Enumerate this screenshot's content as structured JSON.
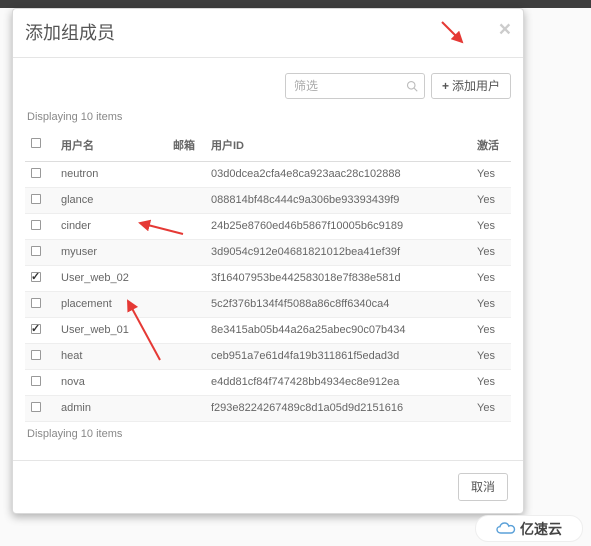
{
  "modal": {
    "title": "添加组成员",
    "filter_placeholder": "筛选",
    "add_button": "添加用户",
    "displaying": "Displaying 10 items",
    "cancel": "取消"
  },
  "columns": {
    "username": "用户名",
    "email": "邮箱",
    "userid": "用户ID",
    "active": "激活"
  },
  "rows": [
    {
      "checked": false,
      "username": "neutron",
      "email": "",
      "userid": "03d0dcea2cfa4e8ca923aac28c102888",
      "active": "Yes"
    },
    {
      "checked": false,
      "username": "glance",
      "email": "",
      "userid": "088814bf48c444c9a306be93393439f9",
      "active": "Yes"
    },
    {
      "checked": false,
      "username": "cinder",
      "email": "",
      "userid": "24b25e8760ed46b5867f10005b6c9189",
      "active": "Yes"
    },
    {
      "checked": false,
      "username": "myuser",
      "email": "",
      "userid": "3d9054c912e04681821012bea41ef39f",
      "active": "Yes"
    },
    {
      "checked": true,
      "username": "User_web_02",
      "email": "",
      "userid": "3f16407953be442583018e7f838e581d",
      "active": "Yes"
    },
    {
      "checked": false,
      "username": "placement",
      "email": "",
      "userid": "5c2f376b134f4f5088a86c8ff6340ca4",
      "active": "Yes"
    },
    {
      "checked": true,
      "username": "User_web_01",
      "email": "",
      "userid": "8e3415ab05b44a26a25abec90c07b434",
      "active": "Yes"
    },
    {
      "checked": false,
      "username": "heat",
      "email": "",
      "userid": "ceb951a7e61d4fa19b311861f5edad3d",
      "active": "Yes"
    },
    {
      "checked": false,
      "username": "nova",
      "email": "",
      "userid": "e4dd81cf84f747428bb4934ec8e912ea",
      "active": "Yes"
    },
    {
      "checked": false,
      "username": "admin",
      "email": "",
      "userid": "f293e8224267489c8d1a05d9d2151616",
      "active": "Yes"
    }
  ],
  "annotations": {
    "arrow_color": "#e53935"
  },
  "watermark": "亿速云"
}
